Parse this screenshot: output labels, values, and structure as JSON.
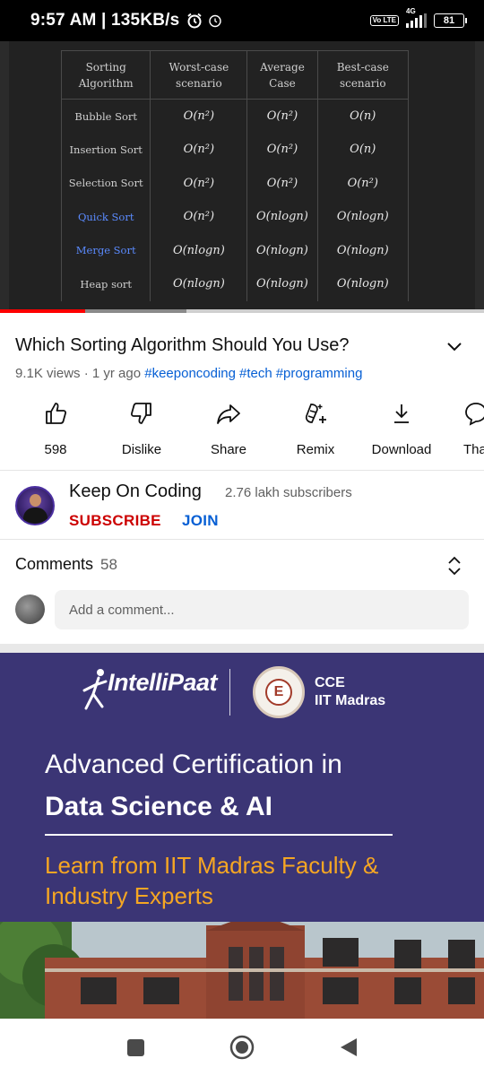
{
  "status_bar": {
    "time": "9:57 AM | 135KB/s",
    "network": "4G",
    "volte": "Vo LTE",
    "battery": "81"
  },
  "video": {
    "table": {
      "headers": [
        "Sorting Algorithm",
        "Worst-case scenario",
        "Average Case",
        "Best-case scenario"
      ],
      "rows": [
        [
          "Bubble Sort",
          "O(n²)",
          "O(n²)",
          "O(n)"
        ],
        [
          "Insertion Sort",
          "O(n²)",
          "O(n²)",
          "O(n)"
        ],
        [
          "Selection Sort",
          "O(n²)",
          "O(n²)",
          "O(n²)"
        ],
        [
          "Quick Sort",
          "O(n²)",
          "O(nlogn)",
          "O(nlogn)"
        ],
        [
          "Merge Sort",
          "O(nlogn)",
          "O(nlogn)",
          "O(nlogn)"
        ],
        [
          "Heap sort",
          "O(nlogn)",
          "O(nlogn)",
          "O(nlogn)"
        ]
      ]
    },
    "progress": {
      "played_fraction": 0.175,
      "buffered_fraction": 0.385
    }
  },
  "details": {
    "title": "Which Sorting Algorithm Should You Use?",
    "views": "9.1K views",
    "age": "1 yr ago",
    "meta_text": "9.1K views · 1 yr ago",
    "hashtags": [
      "#keeponcoding",
      "#tech",
      "#programming"
    ]
  },
  "actions": [
    {
      "name": "like",
      "label": "598"
    },
    {
      "name": "dislike",
      "label": "Dislike"
    },
    {
      "name": "share",
      "label": "Share"
    },
    {
      "name": "remix",
      "label": "Remix"
    },
    {
      "name": "download",
      "label": "Download"
    },
    {
      "name": "thanks",
      "label": "Tha"
    }
  ],
  "channel": {
    "name": "Keep On Coding",
    "subscribers": "2.76 lakh subscribers",
    "subscribe_label": "SUBSCRIBE",
    "join_label": "JOIN"
  },
  "comments": {
    "label": "Comments",
    "count": "58",
    "placeholder": "Add a comment..."
  },
  "ad": {
    "logo": "IntelliPaat",
    "seal_letter": "E",
    "partner_line1": "CCE",
    "partner_line2": "IIT Madras",
    "headline1": "Advanced Certification in",
    "headline2": "Data Science & AI",
    "tagline": "Learn from IIT Madras Faculty & Industry Experts",
    "accent_color": "#f5a623",
    "background_color": "#3b3575"
  },
  "colors": {
    "subscribe": "#cc0000",
    "link": "#065fd4",
    "progress_played": "#ff0000"
  }
}
